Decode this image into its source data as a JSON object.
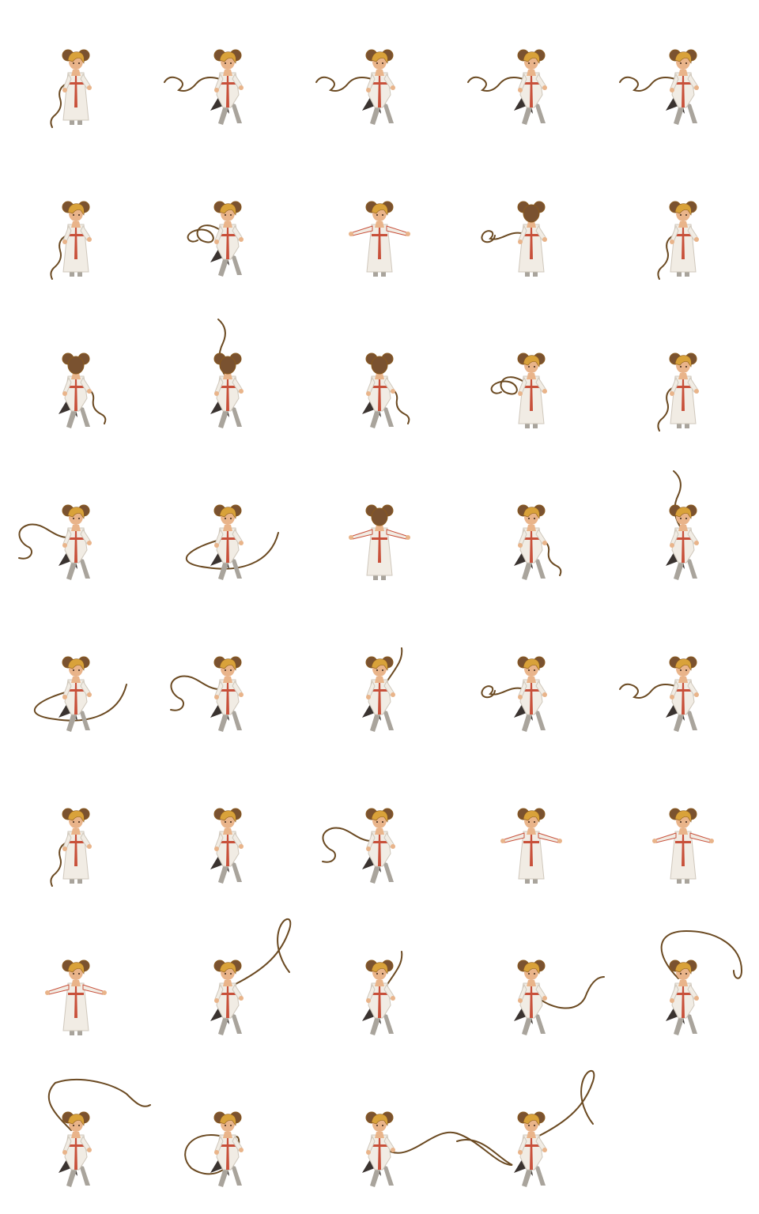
{
  "sheet": {
    "columns": 5,
    "rows": 8,
    "frame_count": 39,
    "background": "#ffffff"
  },
  "palette": {
    "hair": "#d9a23a",
    "hair_dark": "#8a5a1e",
    "bun": "#7a5230",
    "skin": "#e9b48a",
    "robe": "#f1ece4",
    "robe_shade": "#cfc7bb",
    "sash": "#c8503a",
    "cape": "#3a3330",
    "boots": "#a9a49c",
    "whip": "#6b4a22"
  },
  "frames": [
    {
      "pose": "idle-front",
      "whip": "coil-low"
    },
    {
      "pose": "walk",
      "whip": "coil-left"
    },
    {
      "pose": "walk",
      "whip": "coil-left"
    },
    {
      "pose": "walk",
      "whip": "coil-left"
    },
    {
      "pose": "walk",
      "whip": "coil-left"
    },
    {
      "pose": "idle-front",
      "whip": "coil-low"
    },
    {
      "pose": "walk",
      "whip": "loop-left"
    },
    {
      "pose": "arms-out",
      "whip": "none"
    },
    {
      "pose": "walk-back",
      "whip": "tangle-left"
    },
    {
      "pose": "idle-side",
      "whip": "coil-low"
    },
    {
      "pose": "run-back",
      "whip": "coil-right"
    },
    {
      "pose": "run-back",
      "whip": "up-flick"
    },
    {
      "pose": "run-back",
      "whip": "coil-right"
    },
    {
      "pose": "idle-front",
      "whip": "loop-left"
    },
    {
      "pose": "idle-front",
      "whip": "coil-low"
    },
    {
      "pose": "attack",
      "whip": "wave-left"
    },
    {
      "pose": "attack",
      "whip": "sweep-arc"
    },
    {
      "pose": "arms-out-back",
      "whip": "none"
    },
    {
      "pose": "attack",
      "whip": "coil-right"
    },
    {
      "pose": "leap",
      "whip": "up-flick"
    },
    {
      "pose": "attack",
      "whip": "sweep-arc"
    },
    {
      "pose": "attack",
      "whip": "wave-left"
    },
    {
      "pose": "attack",
      "whip": "right-hook"
    },
    {
      "pose": "attack",
      "whip": "tangle-left"
    },
    {
      "pose": "attack",
      "whip": "coil-left"
    },
    {
      "pose": "idle-side",
      "whip": "coil-low"
    },
    {
      "pose": "leap",
      "whip": "none"
    },
    {
      "pose": "attack",
      "whip": "wave-left"
    },
    {
      "pose": "arms-out",
      "whip": "none"
    },
    {
      "pose": "arms-out",
      "whip": "none"
    },
    {
      "pose": "cast",
      "whip": "none"
    },
    {
      "pose": "lash",
      "whip": "up-right-long"
    },
    {
      "pose": "lash",
      "whip": "right-hook"
    },
    {
      "pose": "lash",
      "whip": "low-right"
    },
    {
      "pose": "lash",
      "whip": "overhead-loop"
    },
    {
      "pose": "lash",
      "whip": "overhead-left"
    },
    {
      "pose": "lash",
      "whip": "left-curl"
    },
    {
      "pose": "lash",
      "whip": "s-wave-right"
    },
    {
      "pose": "lash",
      "whip": "up-right-long"
    }
  ]
}
